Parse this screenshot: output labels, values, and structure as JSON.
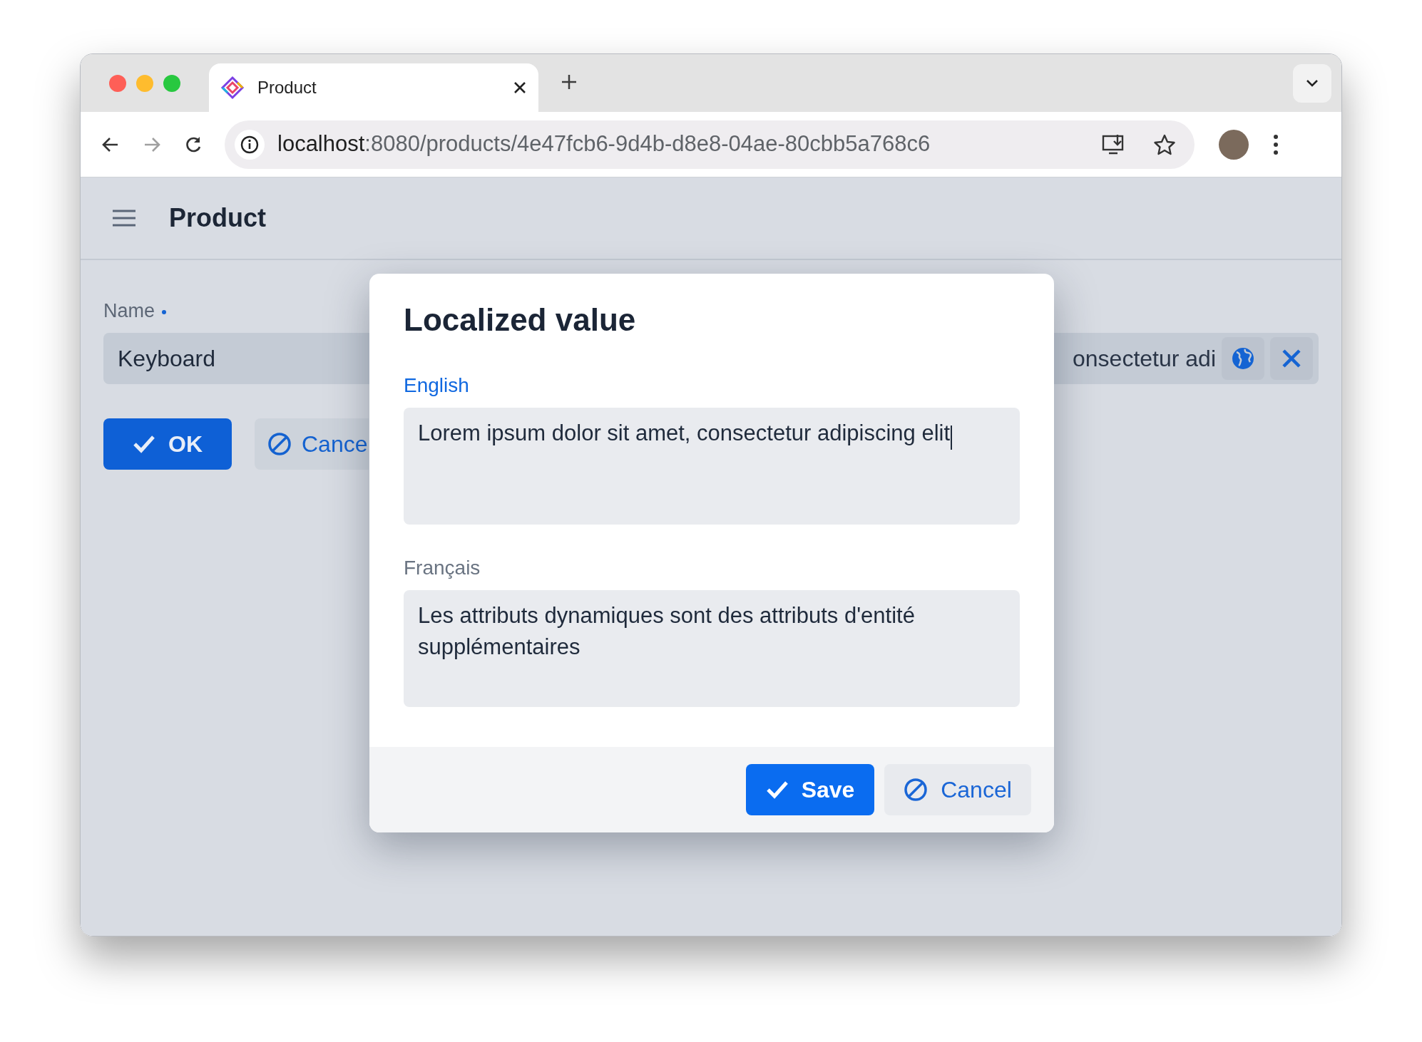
{
  "browser": {
    "tabs": [
      {
        "title": "Product",
        "selected": true
      }
    ],
    "url": {
      "host": "localhost",
      "path": ":8080/products/4e47fcb6-9d4b-d8e8-04ae-80cbb5a768c6"
    },
    "forward_disabled": true
  },
  "app": {
    "title": "Product"
  },
  "form": {
    "name_field": {
      "label": "Name",
      "required": true,
      "value": "Keyboard"
    },
    "second_field": {
      "value": "onsectetur adi"
    },
    "buttons": [
      {
        "label": "OK",
        "kind": "primary"
      },
      {
        "label": "Cance",
        "kind": "secondary"
      }
    ]
  },
  "dialog": {
    "title": "Localized value",
    "fields": [
      {
        "label": "English",
        "value": "Lorem ipsum dolor sit amet, consectetur adipiscing elit",
        "focused": true
      },
      {
        "label": "Français",
        "value": "Les attributs dynamiques sont des attributs d'entité supplémentaires",
        "focused": false
      }
    ],
    "buttons": [
      {
        "label": "Save",
        "kind": "primary"
      },
      {
        "label": "Cancel",
        "kind": "secondary"
      }
    ]
  }
}
